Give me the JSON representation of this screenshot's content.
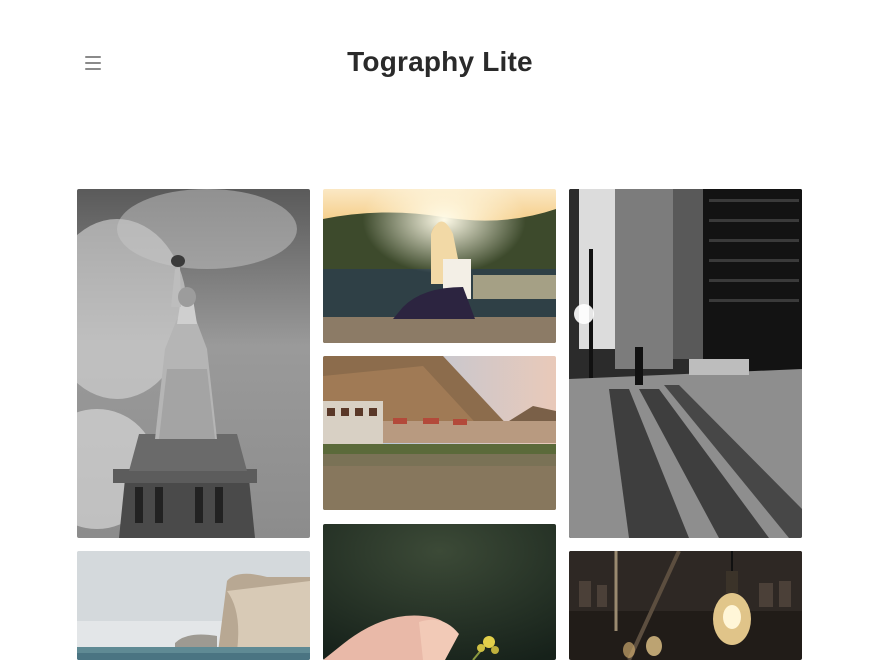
{
  "site": {
    "title": "Tography Lite"
  },
  "header": {
    "menu_icon": "hamburger-menu-icon"
  },
  "gallery": {
    "items": [
      {
        "subject": "statue-of-liberty"
      },
      {
        "subject": "girl-sunset"
      },
      {
        "subject": "city-street"
      },
      {
        "subject": "riverside-town"
      },
      {
        "subject": "cliffs-sea"
      },
      {
        "subject": "hand-flower"
      },
      {
        "subject": "light-bulb"
      }
    ]
  }
}
